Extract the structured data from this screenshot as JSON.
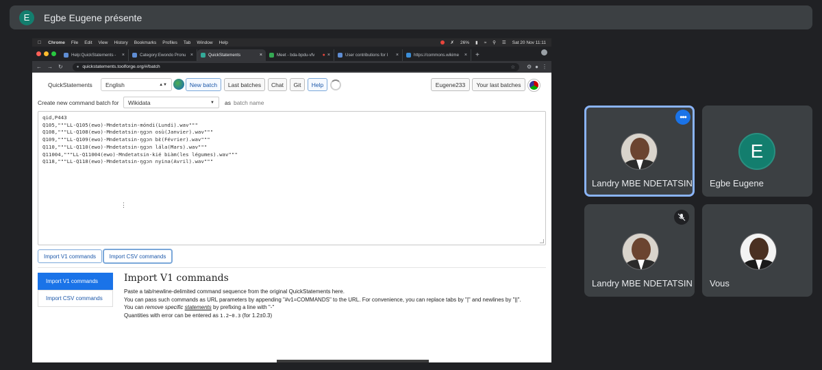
{
  "presenter": {
    "initial": "E",
    "text": "Egbe Eugene présente"
  },
  "macos_menu": {
    "items": [
      "Chrome",
      "File",
      "Edit",
      "View",
      "History",
      "Bookmarks",
      "Profiles",
      "Tab",
      "Window",
      "Help"
    ],
    "battery": "26%",
    "clock": "Sat 20 Nov  11:11"
  },
  "browser": {
    "tabs": [
      {
        "title": "Help:QuickStatements -",
        "active": false
      },
      {
        "title": "Category:Ewondo Pronu",
        "active": false
      },
      {
        "title": "QuickStatements",
        "active": true
      },
      {
        "title": "Meet - bda-bpdu-vfv",
        "active": false
      },
      {
        "title": "User contributions for I",
        "active": false
      },
      {
        "title": "https://commons.wikime",
        "active": false
      }
    ],
    "url": "quickstatements.toolforge.org/#/batch"
  },
  "qs": {
    "brand": "QuickStatements",
    "language": "English",
    "buttons": {
      "new_batch": "New batch",
      "last_batches": "Last batches",
      "chat": "Chat",
      "git": "Git",
      "help": "Help",
      "user": "Eugene233",
      "your_last": "Your last batches"
    },
    "create_label": "Create new command batch for",
    "target": "Wikidata",
    "as_label": "as",
    "batch_name_placeholder": "batch name",
    "commands": [
      "qid,P443",
      "Q105,\"\"\"LL-Q105(ewo)-Mndetatsin-móndi(Lundi).wav\"\"\"",
      "Q108,\"\"\"LL-Q108(ewo)-Mndetatsin-ŋgɔn osù(Janvier).wav\"\"\"",
      "Q109,\"\"\"LL-Q109(ewo)-Mndetatsin-ŋgɔn bɛ̀(Février).wav\"\"\"",
      "Q110,\"\"\"LL-Q110(ewo)-Mndetatsin-ŋgɔn lála(Mars).wav\"\"\"",
      "Q11004,\"\"\"LL-Q11004(ewo)-Mndetatsin-kié biàm(les légumes).wav\"\"\"",
      "Q118,\"\"\"LL-Q118(ewo)-Mndetatsin-ŋgɔn nyina(Avril).wav\"\"\""
    ],
    "import_v1": "Import V1 commands",
    "import_csv": "Import CSV commands",
    "side_tabs": [
      "Import V1 commands",
      "Import CSV commands"
    ],
    "help": {
      "heading": "Import V1 commands",
      "p1": "Paste a tab/newline-delimited command sequence from the original QuickStatements here.",
      "p2": "You can pass such commands as URL parameters by appending \"#v1=COMMANDS\" to the URL. For convenience, you can replace tabs by \"|\" and newlines by \"||\".",
      "p3a": "You can ",
      "p3b": "remove specific ",
      "p3c": "statements",
      "p3d": " by prefixing a line with \"-\"",
      "p4a": "Quantities with error can be entered as ",
      "p4b": "1.2~0.3",
      "p4c": " (for 1.2±0.3)"
    }
  },
  "participants": [
    {
      "name": "Landry MBE NDETATSIN",
      "kind": "photo",
      "speaking": true,
      "muted": false
    },
    {
      "name": "Egbe Eugene",
      "kind": "avatar",
      "initial": "E",
      "speaking": false,
      "muted": false
    },
    {
      "name": "Landry MBE NDETATSIN",
      "kind": "photo",
      "speaking": false,
      "muted": true
    },
    {
      "name": "Vous",
      "kind": "photo",
      "speaking": false,
      "muted": false
    }
  ]
}
